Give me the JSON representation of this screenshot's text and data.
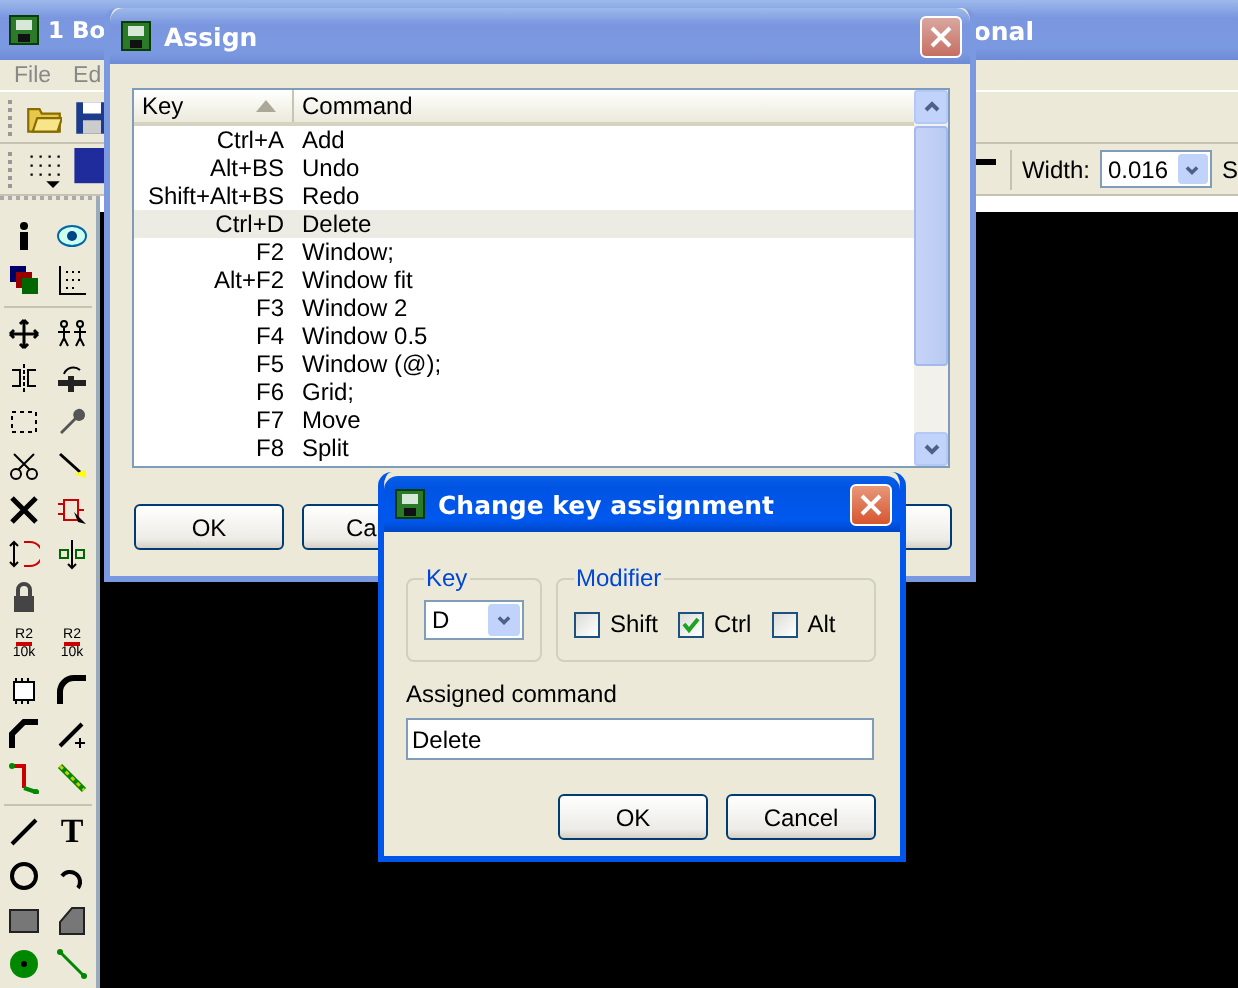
{
  "app": {
    "title_start": "1 Bo",
    "title_end": "onal",
    "menu": [
      "File",
      "Ed"
    ],
    "width_label": "Width:",
    "width_value": "0.016",
    "cut_label": "S",
    "resistor_labels": [
      {
        "top": "R2",
        "bottom": "10k"
      },
      {
        "top": "R2",
        "bottom": "10k"
      }
    ],
    "text_tool": "T"
  },
  "assign": {
    "title": "Assign",
    "columns": [
      {
        "label": "Key",
        "sorted": true
      },
      {
        "label": "Command",
        "sorted": false
      }
    ],
    "rows": [
      {
        "key": "Ctrl+A",
        "command": "Add",
        "selected": false
      },
      {
        "key": "Alt+BS",
        "command": "Undo",
        "selected": false
      },
      {
        "key": "Shift+Alt+BS",
        "command": "Redo",
        "selected": false
      },
      {
        "key": "Ctrl+D",
        "command": "Delete",
        "selected": true
      },
      {
        "key": "F2",
        "command": "Window;",
        "selected": false
      },
      {
        "key": "Alt+F2",
        "command": "Window fit",
        "selected": false
      },
      {
        "key": "F3",
        "command": "Window 2",
        "selected": false
      },
      {
        "key": "F4",
        "command": "Window 0.5",
        "selected": false
      },
      {
        "key": "F5",
        "command": "Window (@);",
        "selected": false
      },
      {
        "key": "F6",
        "command": "Grid;",
        "selected": false
      },
      {
        "key": "F7",
        "command": "Move",
        "selected": false
      },
      {
        "key": "F8",
        "command": "Split",
        "selected": false
      }
    ],
    "buttons": [
      "OK",
      "Ca"
    ]
  },
  "change": {
    "title": "Change key assignment",
    "key_group": "Key",
    "key_value": "D",
    "modifier_group": "Modifier",
    "modifiers": [
      {
        "label": "Shift",
        "checked": false
      },
      {
        "label": "Ctrl",
        "checked": true
      },
      {
        "label": "Alt",
        "checked": false
      }
    ],
    "command_label": "Assigned command",
    "command_value": "Delete",
    "buttons": [
      "OK",
      "Cancel"
    ]
  }
}
